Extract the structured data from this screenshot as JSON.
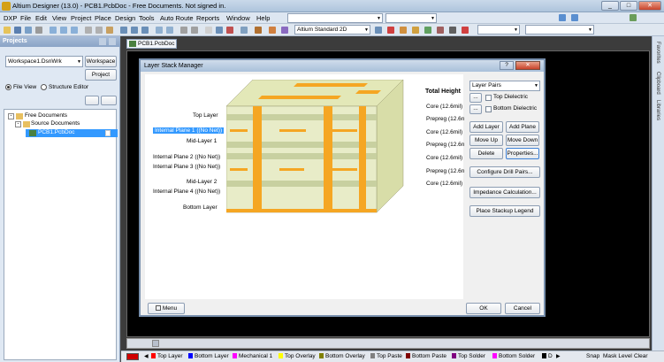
{
  "window": {
    "title": "Altium Designer (13.0) - PCB1.PcbDoc - Free Documents. Not signed in.",
    "min": "_",
    "max": "□",
    "close": "✕"
  },
  "menu": [
    "DXP",
    "File",
    "Edit",
    "View",
    "Project",
    "Place",
    "Design",
    "Tools",
    "Auto Route",
    "Reports",
    "Window",
    "Help"
  ],
  "toolbar": {
    "view_combo": "Altium Standard 2D"
  },
  "projects": {
    "title": "Projects",
    "workspace_value": "Workspace1.DsnWrk",
    "workspace_btn": "Workspace",
    "project_btn": "Project",
    "file_view": "File View",
    "structure_editor": "Structure Editor",
    "tree": {
      "root": "Free Documents",
      "group": "Source Documents",
      "doc": "PCB1.PcbDoc"
    }
  },
  "doc_tab": "PCB1.PcbDoc",
  "right_strip": [
    "Favorites",
    "Clipboard",
    "Libraries"
  ],
  "dialog": {
    "title": "Layer Stack Manager",
    "help_btn": "?",
    "close_btn": "✕",
    "total_height": "Total Height",
    "layers": [
      "Top Layer",
      "Internal Plane 1 ((No Net))",
      "Mid-Layer 1",
      "Internal Plane 2 ((No Net))",
      "Internal Plane 3 ((No Net))",
      "Mid-Layer 2",
      "Internal Plane 4 ((No Net))",
      "Bottom Layer"
    ],
    "thickness": [
      "Core (12.6mil)",
      "Prepreg (12.6n",
      "Core (12.6mil)",
      "Prepreg (12.6n",
      "Core (12.6mil)",
      "Prepreg (12.6n",
      "Core (12.6mil)"
    ],
    "stack_combo": "Layer Pairs",
    "top_dielectric": "Top Dielectric",
    "bottom_dielectric": "Bottom Dielectric",
    "dots": "...",
    "add_layer": "Add Layer",
    "add_plane": "Add Plane",
    "move_up": "Move Up",
    "move_down": "Move Down",
    "delete": "Delete",
    "properties": "Properties...",
    "drill_pairs": "Configure Drill Pairs...",
    "impedance": "Impedance Calculation...",
    "legend": "Place Stackup Legend",
    "menu_btn": "Menu",
    "ok": "OK",
    "cancel": "Cancel"
  },
  "layer_tabs": [
    {
      "label": "Top Layer",
      "color": "#ff0000"
    },
    {
      "label": "Bottom Layer",
      "color": "#0000ff"
    },
    {
      "label": "Mechanical 1",
      "color": "#ff00ff"
    },
    {
      "label": "Top Overlay",
      "color": "#ffff00"
    },
    {
      "label": "Bottom Overlay",
      "color": "#808000"
    },
    {
      "label": "Top Paste",
      "color": "#808080"
    },
    {
      "label": "Bottom Paste",
      "color": "#800000"
    },
    {
      "label": "Top Solder",
      "color": "#800080"
    },
    {
      "label": "Bottom Solder",
      "color": "#ff00ff"
    },
    {
      "label": "D",
      "color": "#000000"
    }
  ],
  "status_right": [
    "Snap",
    "Mask Level",
    "Clear"
  ]
}
